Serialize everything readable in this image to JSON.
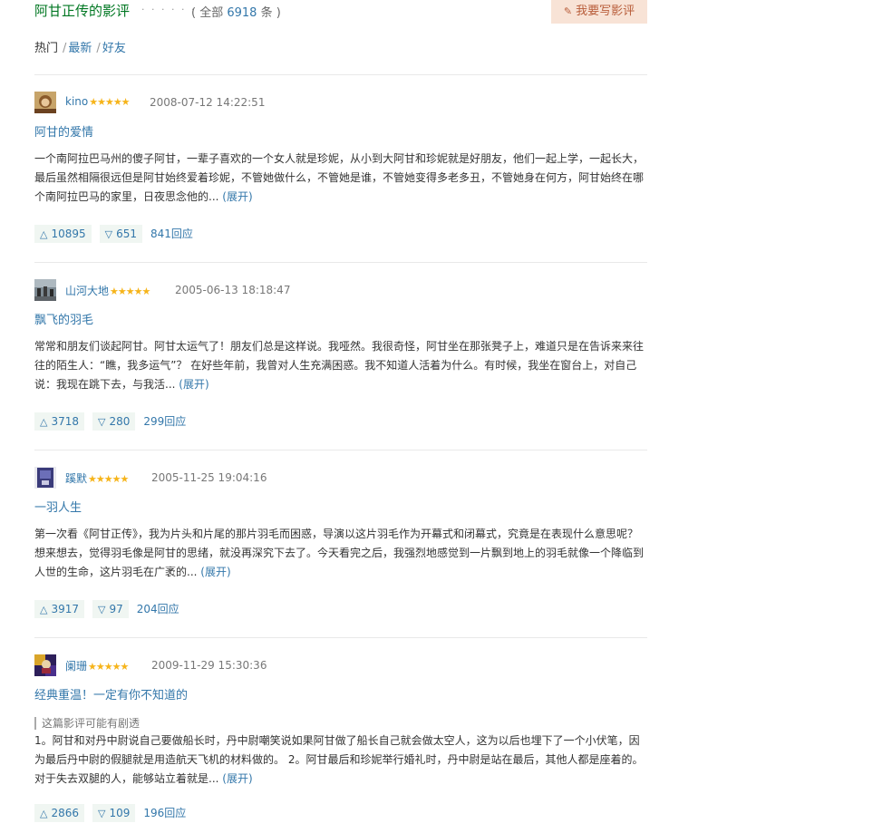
{
  "header": {
    "title": "阿甘正传的影评",
    "dots": "· · · · · ·",
    "count_open": "( 全部 ",
    "count_num": "6918",
    "count_close": " 条 )",
    "write_button": "我要写影评"
  },
  "tabs": [
    {
      "label": "热门",
      "sep": "/"
    },
    {
      "label": "最新",
      "sep": "/"
    },
    {
      "label": "好友",
      "sep": ""
    }
  ],
  "reviews": [
    {
      "user": "kino",
      "stars": "★★★★★",
      "time": "2008-07-12 14:22:51",
      "title": "阿甘的爱情",
      "spoiler": "",
      "body": "一个南阿拉巴马州的傻子阿甘，一辈子喜欢的一个女人就是珍妮，从小到大阿甘和珍妮就是好朋友，他们一起上学，一起长大，最后虽然相隔很远但是阿甘始终爱着珍妮，不管她做什么，不管她是谁，不管她变得多老多丑，不管她身在何方，阿甘始终在哪个南阿拉巴马的家里，日夜思念他的...",
      "expand": "(展开)",
      "useful": "10895",
      "useless": "651",
      "replies": "841回应"
    },
    {
      "user": "山河大地",
      "stars": "★★★★★",
      "time": "2005-06-13 18:18:47",
      "title": "飘飞的羽毛",
      "spoiler": "",
      "body": "常常和朋友们谈起阿甘。阿甘太运气了！朋友们总是这样说。我哑然。我很奇怪，阿甘坐在那张凳子上，难道只是在告诉来来往往的陌生人：“瞧，我多运气”？ 在好些年前，我曾对人生充满困惑。我不知道人活着为什么。有时候，我坐在窗台上，对自己说：我现在跳下去，与我活...",
      "expand": "(展开)",
      "useful": "3718",
      "useless": "280",
      "replies": "299回应"
    },
    {
      "user": "蹊默",
      "stars": "★★★★★",
      "time": "2005-11-25 19:04:16",
      "title": "一羽人生",
      "spoiler": "",
      "body": "第一次看《阿甘正传》，我为片头和片尾的那片羽毛而困惑，导演以这片羽毛作为开幕式和闭幕式，究竟是在表现什么意思呢？想来想去，觉得羽毛像是阿甘的思绪，就没再深究下去了。今天看完之后，我强烈地感觉到一片飘到地上的羽毛就像一个降临到人世的生命，这片羽毛在广袤的...",
      "expand": "(展开)",
      "useful": "3917",
      "useless": "97",
      "replies": "204回应"
    },
    {
      "user": "阑珊",
      "stars": "★★★★★",
      "time": "2009-11-29 15:30:36",
      "title": "经典重温！一定有你不知道的",
      "spoiler": "这篇影评可能有剧透",
      "body": "1。阿甘和对丹中尉说自己要做船长时，丹中尉嘲笑说如果阿甘做了船长自己就会做太空人，这为以后也埋下了一个小伏笔，因为最后丹中尉的假腿就是用造航天飞机的材料做的。 2。阿甘最后和珍妮举行婚礼时，丹中尉是站在最后，其他人都是座着的。对于失去双腿的人，能够站立着就是...",
      "expand": "(展开)",
      "useful": "2866",
      "useless": "109",
      "replies": "196回应"
    }
  ],
  "icons": {
    "write": "pencil-icon",
    "useful": "triangle-up-icon",
    "useless": "triangle-down-icon"
  },
  "colors": {
    "title_green": "#007722",
    "link_blue": "#3377aa",
    "star_orange": "#f6b41a",
    "button_bg": "#f8e3d6",
    "vote_bg": "#f0f6f2"
  }
}
